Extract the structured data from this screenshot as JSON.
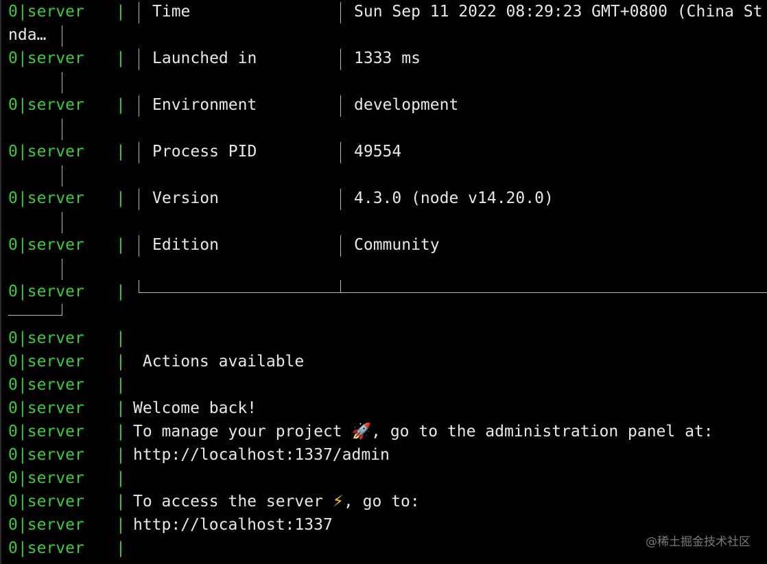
{
  "process_prefix": {
    "pid": "0",
    "separator": "|",
    "name": "server",
    "pipe": "|"
  },
  "table": {
    "rows": [
      {
        "key": "Time",
        "value": "Sun Sep 11 2022 08:29:23 GMT+0800 (China St",
        "wrap": "nda…"
      },
      {
        "key": "Launched in",
        "value": "1333 ms",
        "wrap": ""
      },
      {
        "key": "Environment",
        "value": "development",
        "wrap": ""
      },
      {
        "key": "Process PID",
        "value": "49554",
        "wrap": ""
      },
      {
        "key": "Version",
        "value": "4.3.0 (node v14.20.0)",
        "wrap": ""
      },
      {
        "key": "Edition",
        "value": "Community",
        "wrap": ""
      }
    ]
  },
  "messages": {
    "actions_heading": " Actions available",
    "welcome": "Welcome back!",
    "manage_before": "To manage your project ",
    "manage_icon": "🚀",
    "manage_after": ", go to the administration panel at:",
    "admin_url": "http://localhost:1337/admin",
    "access_before": "To access the server ",
    "access_icon": "⚡",
    "access_after": ", go to:",
    "server_url": "http://localhost:1337"
  },
  "watermark": "@稀土掘金技术社区",
  "colors": {
    "background": "#000000",
    "prefix_green": "#3ccb3c",
    "text": "#e8e8e8",
    "border": "#bdbdbd"
  }
}
